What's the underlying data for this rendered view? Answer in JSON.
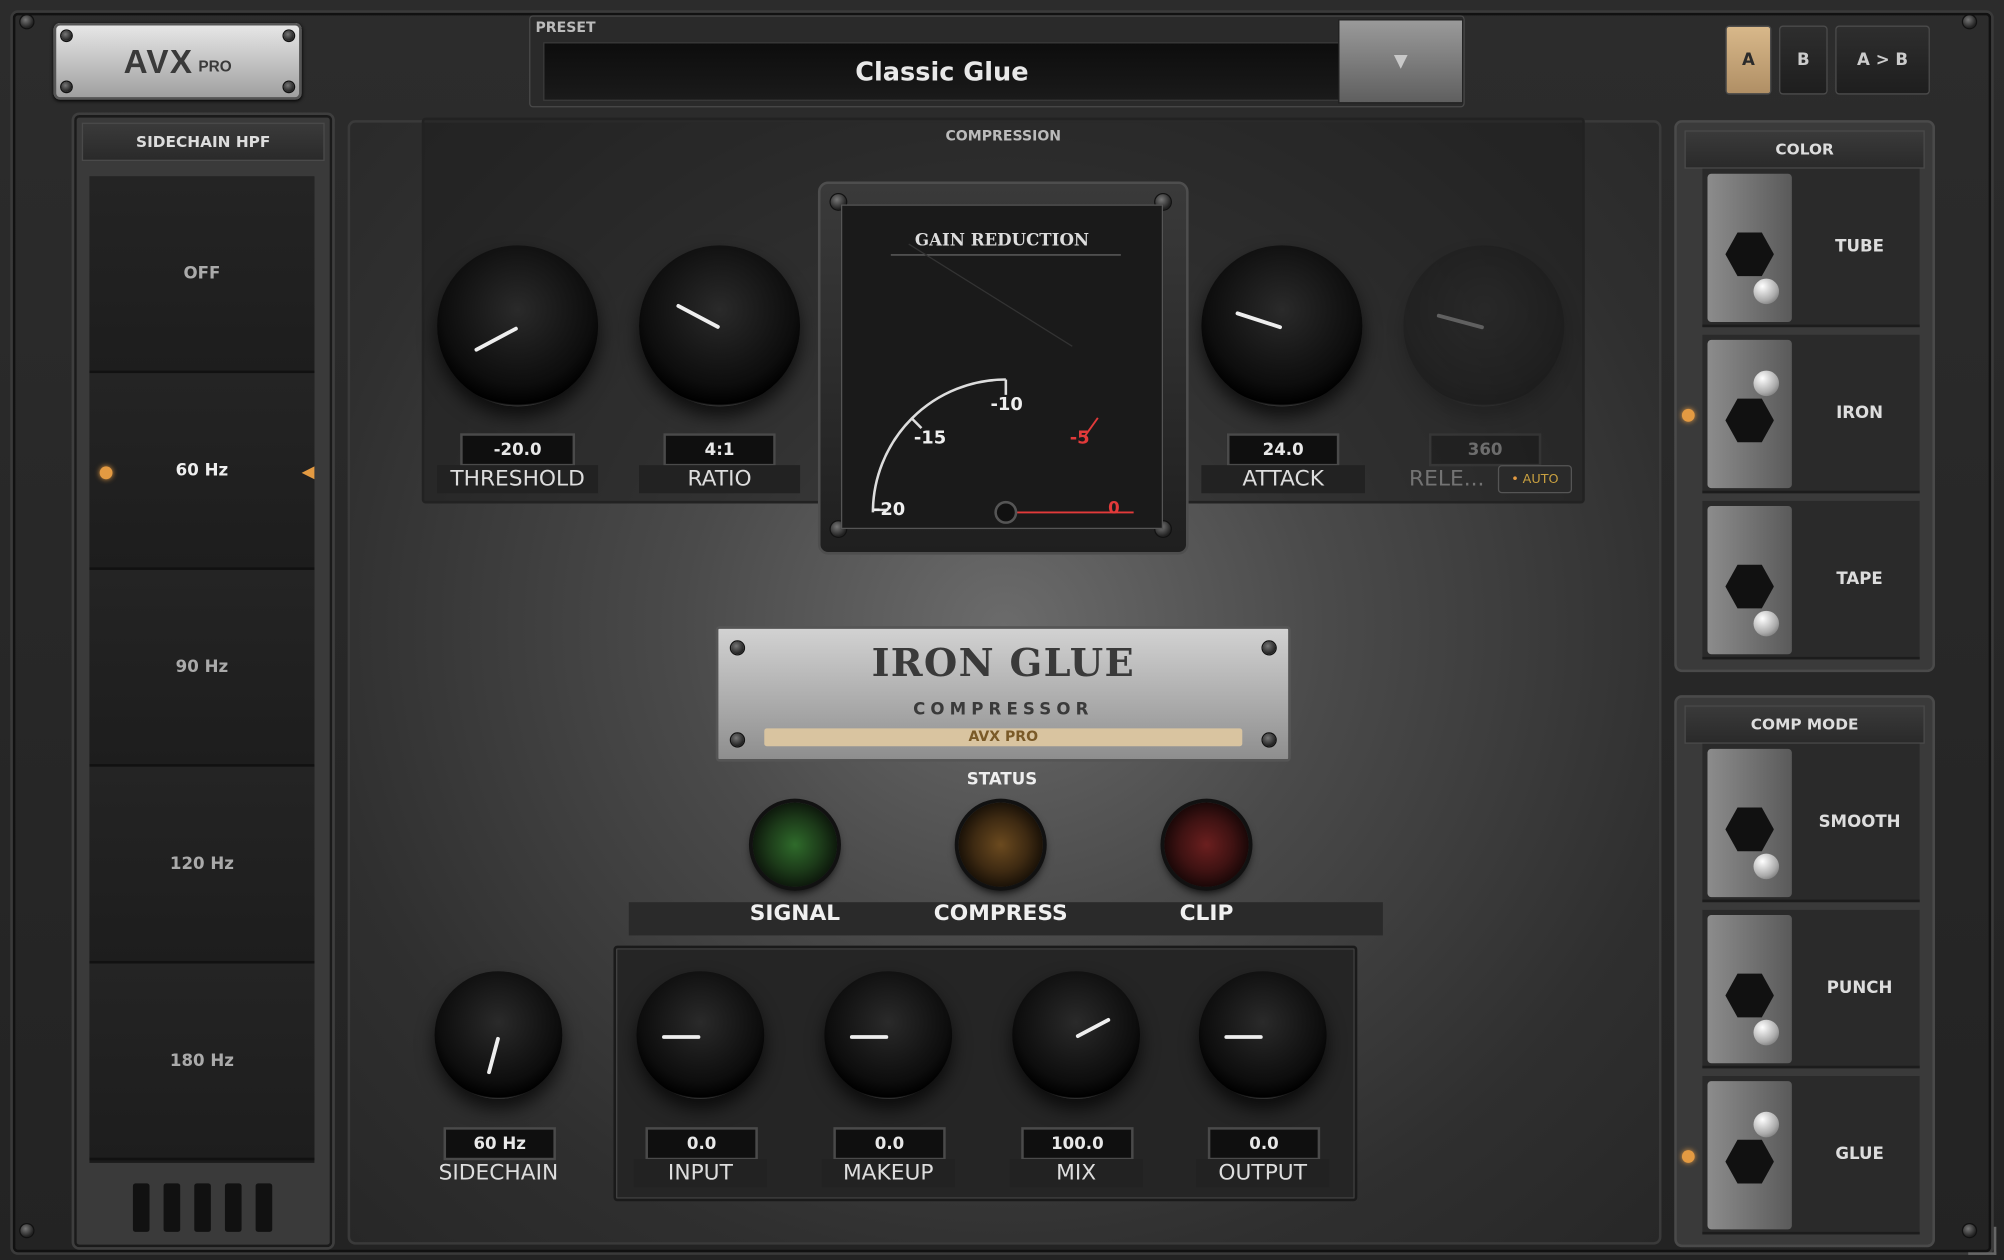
{
  "header": {
    "logo_main": "AVX",
    "logo_sub": "PRO",
    "preset_label": "PRESET",
    "preset_value": "Classic Glue",
    "preset_dropdown_icon": "chevron-down-icon",
    "ab_buttons": [
      "A",
      "B",
      "A > B"
    ],
    "ab_selected": "A"
  },
  "sidechain_hpf": {
    "title": "SIDECHAIN HPF",
    "options": [
      "OFF",
      "60 Hz",
      "90 Hz",
      "120 Hz",
      "180 Hz"
    ],
    "selected": "60 Hz"
  },
  "compression": {
    "title": "COMPRESSION",
    "threshold": {
      "label": "THRESHOLD",
      "value": "-20.0"
    },
    "ratio": {
      "label": "RATIO",
      "value": "4:1"
    },
    "attack": {
      "label": "ATTACK",
      "value": "24.0"
    },
    "release": {
      "label": "RELE...",
      "value": "360",
      "enabled": false
    },
    "auto_label": "AUTO"
  },
  "meter": {
    "title": "GAIN REDUCTION",
    "scale": [
      "-20",
      "-15",
      "-10",
      "-5",
      "0"
    ]
  },
  "nameplate": {
    "title": "IRON GLUE",
    "subtitle": "COMPRESSOR",
    "brand": "AVX PRO"
  },
  "status": {
    "title": "STATUS",
    "leds": [
      {
        "label": "SIGNAL",
        "color": "#2f6b2b"
      },
      {
        "label": "COMPRESS",
        "color": "#6b4a1f"
      },
      {
        "label": "CLIP",
        "color": "#6b1f1f"
      }
    ]
  },
  "bottom_controls": {
    "sidechain": {
      "label": "SIDECHAIN",
      "value": "60 Hz"
    },
    "input": {
      "label": "INPUT",
      "value": "0.0"
    },
    "makeup": {
      "label": "MAKEUP",
      "value": "0.0"
    },
    "mix": {
      "label": "MIX",
      "value": "100.0"
    },
    "output": {
      "label": "OUTPUT",
      "value": "0.0"
    }
  },
  "color_panel": {
    "title": "COLOR",
    "options": [
      "TUBE",
      "IRON",
      "TAPE"
    ],
    "selected": "IRON"
  },
  "comp_mode_panel": {
    "title": "COMP MODE",
    "options": [
      "SMOOTH",
      "PUNCH",
      "GLUE"
    ],
    "selected": "GLUE"
  },
  "colors": {
    "accent_orange": "#e39a42",
    "ab_selected": "#c9a77a",
    "meter_red": "#e23a3a"
  }
}
